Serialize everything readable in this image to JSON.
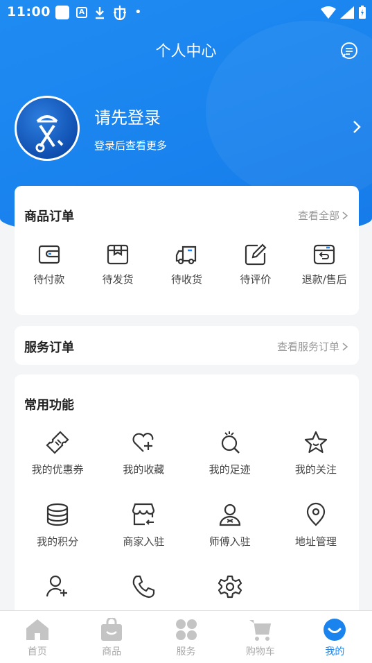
{
  "status_bar": {
    "time": "11:00",
    "a_badge": "A",
    "dot": "•"
  },
  "header": {
    "title": "个人中心"
  },
  "profile": {
    "login_title": "请先登录",
    "login_subtitle": "登录后查看更多"
  },
  "goods_orders": {
    "title": "商品订单",
    "more": "查看全部",
    "items": [
      {
        "label": "待付款",
        "icon": "wallet-icon"
      },
      {
        "label": "待发货",
        "icon": "package-icon"
      },
      {
        "label": "待收货",
        "icon": "truck-icon"
      },
      {
        "label": "待评价",
        "icon": "edit-icon"
      },
      {
        "label": "退款/售后",
        "icon": "refund-box-icon"
      }
    ]
  },
  "service_orders": {
    "title": "服务订单",
    "more": "查看服务订单"
  },
  "common_functions": {
    "title": "常用功能",
    "items": [
      {
        "label": "我的优惠券",
        "icon": "coupon-icon"
      },
      {
        "label": "我的收藏",
        "icon": "heart-plus-icon"
      },
      {
        "label": "我的足迹",
        "icon": "footprint-icon"
      },
      {
        "label": "我的关注",
        "icon": "star-icon"
      },
      {
        "label": "我的积分",
        "icon": "coins-icon"
      },
      {
        "label": "商家入驻",
        "icon": "shop-icon"
      },
      {
        "label": "师傅入驻",
        "icon": "worker-icon"
      },
      {
        "label": "地址管理",
        "icon": "location-icon"
      },
      {
        "label": "",
        "icon": "user-add-icon"
      },
      {
        "label": "",
        "icon": "phone-icon"
      },
      {
        "label": "",
        "icon": "settings-icon"
      }
    ]
  },
  "tabbar": {
    "items": [
      {
        "label": "首页",
        "icon": "home-icon",
        "active": false
      },
      {
        "label": "商品",
        "icon": "bag-icon",
        "active": false
      },
      {
        "label": "服务",
        "icon": "grid-icon",
        "active": false
      },
      {
        "label": "购物车",
        "icon": "cart-icon",
        "active": false
      },
      {
        "label": "我的",
        "icon": "profile-icon",
        "active": true
      }
    ]
  },
  "colors": {
    "primary": "#1a83ee",
    "inactive_tab": "#c4c4c4",
    "background": "#f4f5f7"
  }
}
